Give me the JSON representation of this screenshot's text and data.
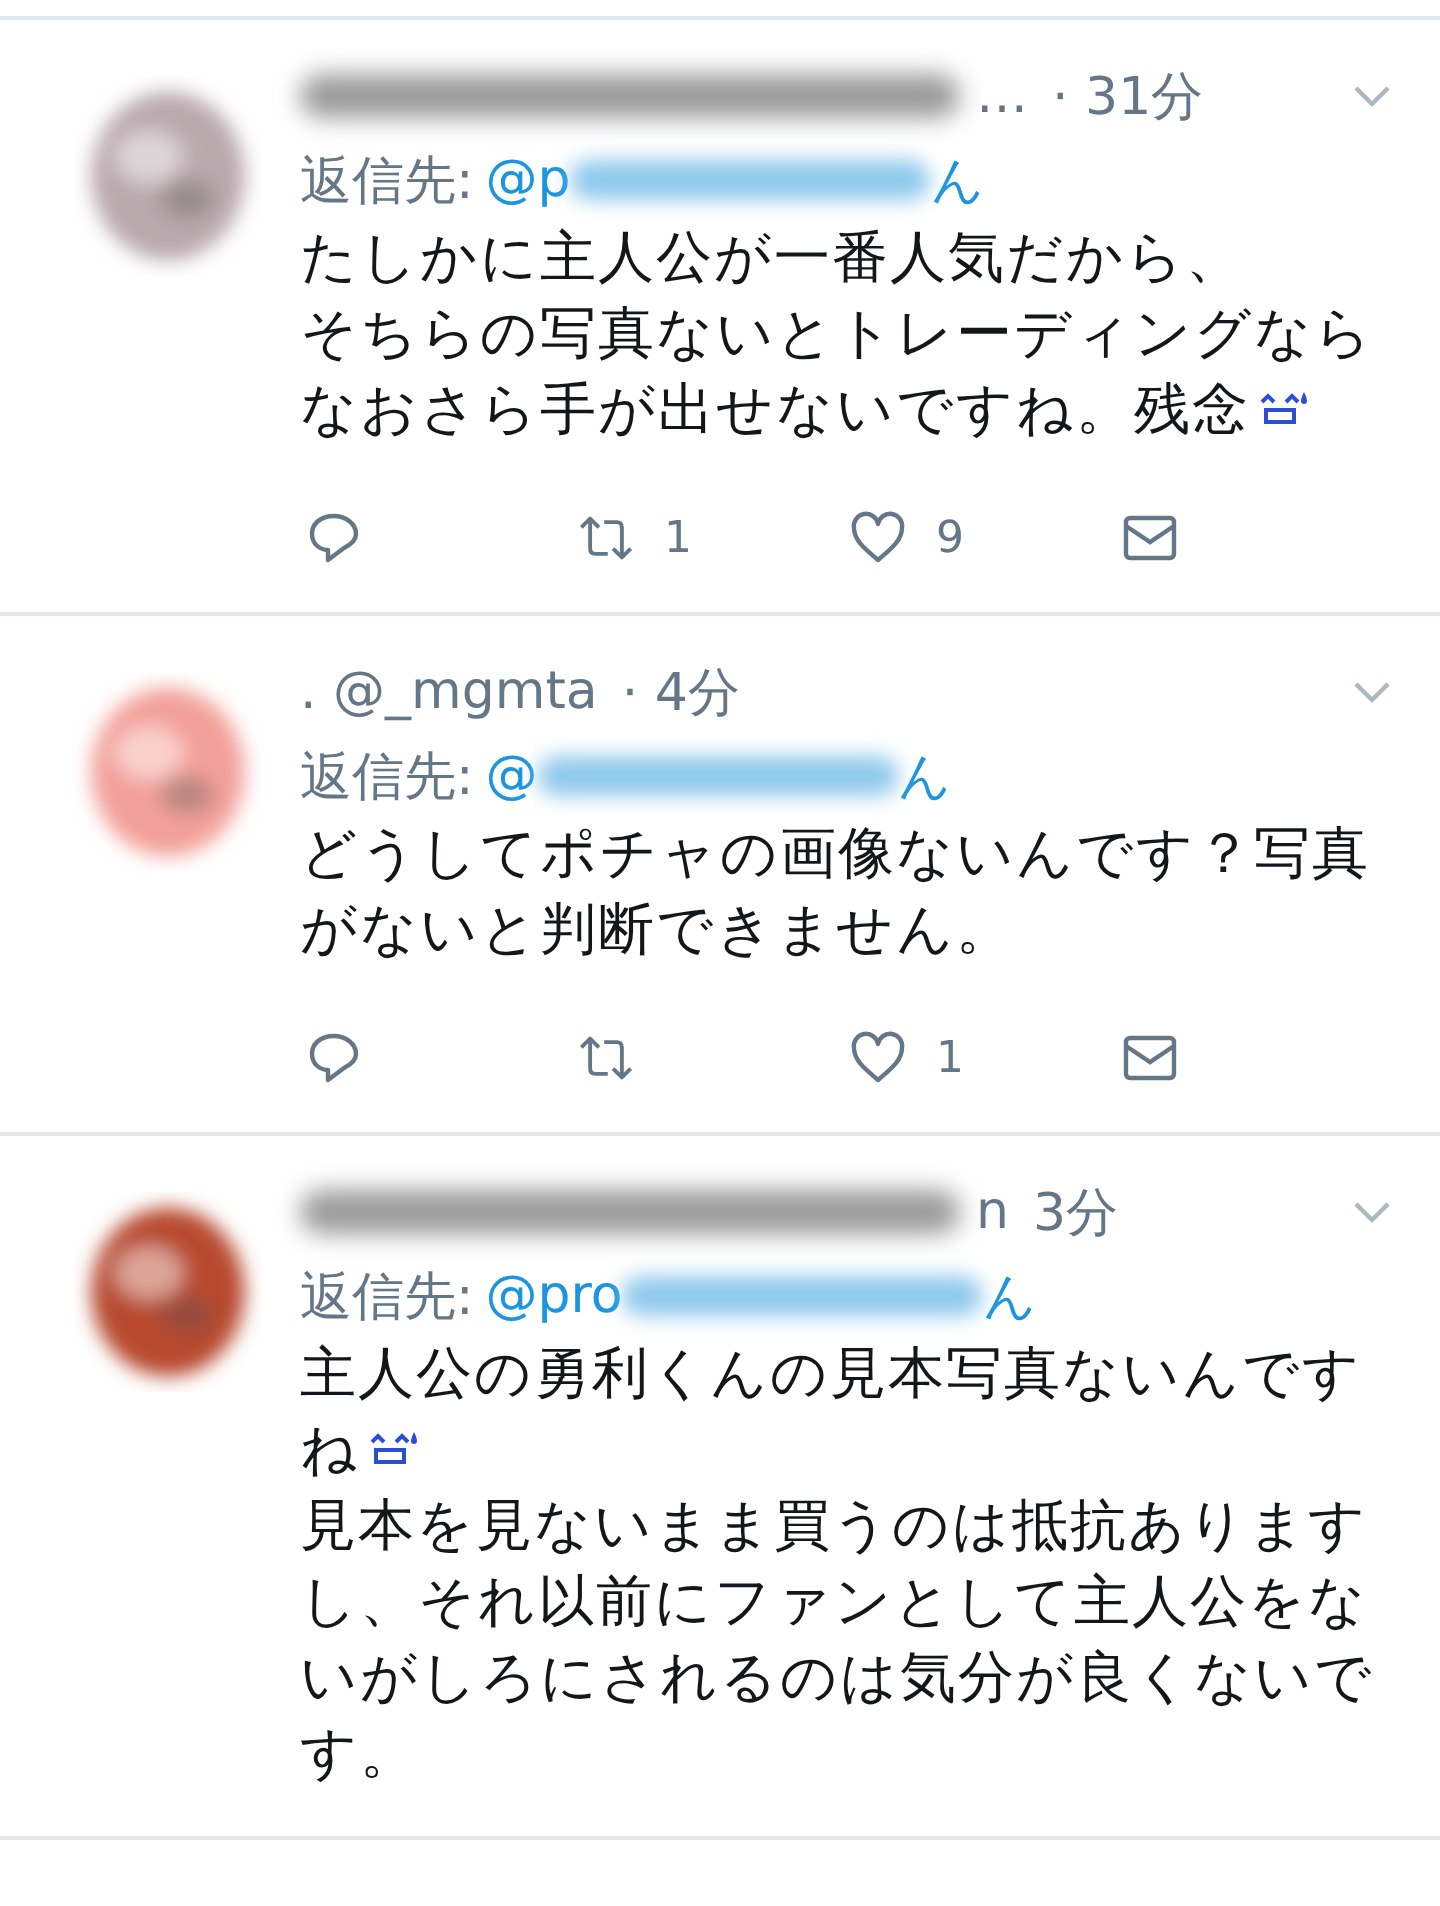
{
  "tweets": [
    {
      "avatar": {
        "kind": "picture",
        "color": "#b9a9ad"
      },
      "header": {
        "blurred": true,
        "lead": "…",
        "time": "· 31分"
      },
      "reply": {
        "prefix": "返信先:",
        "handle_start": "@p",
        "handle_end": "ん"
      },
      "paragraphs": [
        {
          "text": "たしかに主人公が一番人気だから、",
          "emoji": false
        },
        {
          "text": "そちらの写真ないとトレーディングならなおさら手が出せないですね。残念",
          "emoji": true
        }
      ],
      "actions": {
        "retweets": "1",
        "likes": "9"
      }
    },
    {
      "avatar": {
        "kind": "picture",
        "color": "#f2a09a"
      },
      "header": {
        "blurred": false,
        "lead": ". @_mgmta",
        "time": "· 4分"
      },
      "reply": {
        "prefix": "返信先:",
        "handle_start": "@",
        "handle_end": "ん"
      },
      "paragraphs": [
        {
          "text": "どうしてポチャの画像ないんです？写真がないと判断できません。",
          "emoji": false
        }
      ],
      "actions": {
        "likes": "1"
      }
    },
    {
      "avatar": {
        "kind": "picture",
        "color": "#b8482f"
      },
      "header": {
        "blurred": true,
        "lead": "n",
        "time": "3分"
      },
      "reply": {
        "prefix": "返信先:",
        "handle_start": "@pro",
        "handle_end": "ん"
      },
      "paragraphs": [
        {
          "text": "主人公の勇利くんの見本写真ないんですね",
          "emoji": true
        },
        {
          "text": "見本を見ないまま買うのは抵抗ありますし、それ以前にファンとして主人公をないがしろにされるのは気分が良くないです。",
          "emoji": false
        }
      ]
    }
  ]
}
